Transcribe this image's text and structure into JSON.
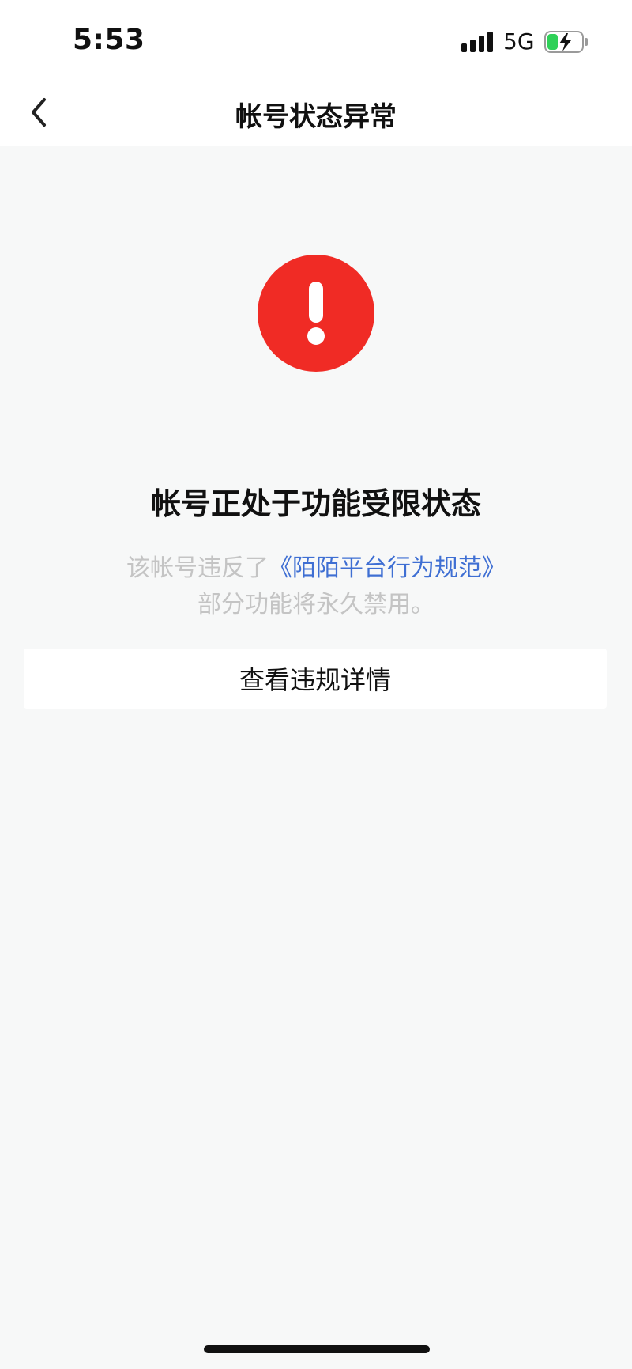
{
  "status_bar": {
    "time": "5:53",
    "network": "5G",
    "battery_color": "#2fd158",
    "signal_icon": "signal-bars-icon",
    "battery_icon": "battery-charging-icon"
  },
  "nav": {
    "title": "帐号状态异常",
    "back_icon": "chevron-left-icon"
  },
  "alert": {
    "icon": "exclamation-circle-icon",
    "color": "#f02b25"
  },
  "main": {
    "headline": "帐号正处于功能受限状态",
    "desc_prefix": "该帐号违反了",
    "desc_link": "《陌陌平台行为规范》",
    "desc_line2": "部分功能将永久禁用。",
    "link_color": "#3f6fd3"
  },
  "actions": {
    "view_details_label": "查看违规详情"
  }
}
